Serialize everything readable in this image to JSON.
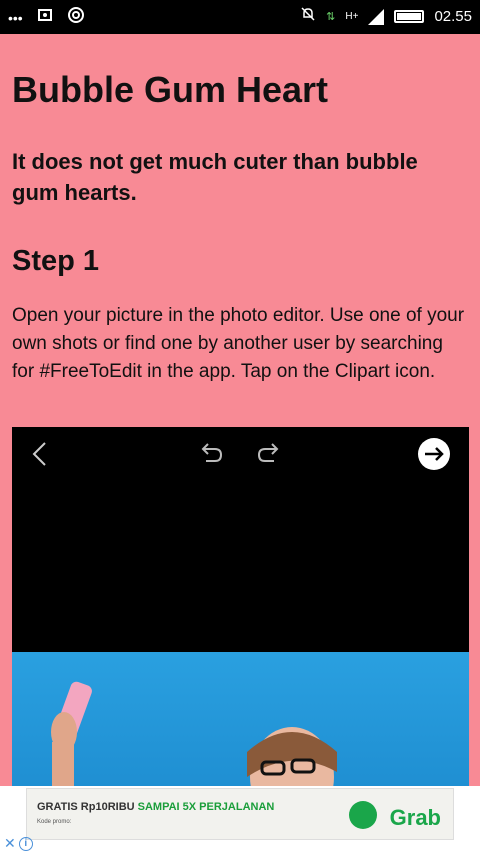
{
  "status_bar": {
    "time": "02.55",
    "network": "H+",
    "icons_left": [
      "dots-icon",
      "screenshot-icon",
      "wifi-icon"
    ],
    "icons_right": [
      "mute-icon",
      "data-icon",
      "signal-icon",
      "battery-icon"
    ]
  },
  "article": {
    "title": "Bubble Gum Heart",
    "subtitle": "It does not get much cuter than bubble gum hearts.",
    "step_heading": "Step 1",
    "paragraph": "Open your picture in the photo editor. Use one of your own shots or find one by another user by searching for #FreeToEdit in the app. Tap on the Clipart icon."
  },
  "editor": {
    "icons": [
      "back-icon",
      "undo-icon",
      "redo-icon",
      "next-icon"
    ]
  },
  "ad": {
    "headline": "GRATIS Rp10RIBU ",
    "headline_highlight": "SAMPAI 5X PERJALANAN",
    "promo_label": "Kode promo:",
    "brand": "Grab"
  },
  "colors": {
    "background": "#f88a95",
    "grab_green": "#1aa64a"
  }
}
